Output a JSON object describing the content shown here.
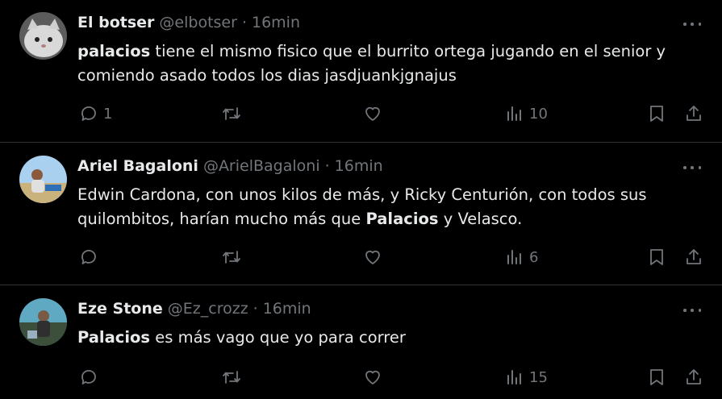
{
  "tweets": [
    {
      "name": "El botser",
      "handle": "@elbotser",
      "time": "16min",
      "text_parts": [
        {
          "bold": true,
          "t": "palacios"
        },
        {
          "bold": false,
          "t": " tiene el mismo fisico que el burrito ortega jugando en el senior y comiendo asado todos los dias jasdjuankjgnajus"
        }
      ],
      "reply_count": "1",
      "retweet_count": "",
      "like_count": "",
      "views": "10",
      "avatar_colors": [
        "#8a8a8a",
        "#e6e6e6"
      ]
    },
    {
      "name": "Ariel Bagaloni",
      "handle": "@ArielBagaloni",
      "time": "16min",
      "text_parts": [
        {
          "bold": false,
          "t": "Edwin Cardona, con unos kilos de más, y Ricky Centurión, con todos sus quilombitos, harían mucho más que "
        },
        {
          "bold": true,
          "t": "Palacios"
        },
        {
          "bold": false,
          "t": " y Velasco."
        }
      ],
      "reply_count": "",
      "retweet_count": "",
      "like_count": "",
      "views": "6",
      "avatar_colors": [
        "#9fc6e6",
        "#c8b07a"
      ]
    },
    {
      "name": "Eze Stone",
      "handle": "@Ez_crozz",
      "time": "16min",
      "text_parts": [
        {
          "bold": true,
          "t": "Palacios"
        },
        {
          "bold": false,
          "t": " es más vago que yo para correr"
        }
      ],
      "reply_count": "",
      "retweet_count": "",
      "like_count": "",
      "views": "15",
      "avatar_colors": [
        "#5fa9c2",
        "#3b4f3a"
      ]
    }
  ],
  "icons": {
    "more": "more-horizontal-icon",
    "reply": "reply-bubble-icon",
    "retweet": "retweet-icon",
    "like": "heart-icon",
    "views": "bar-chart-icon",
    "bookmark": "bookmark-icon",
    "share": "share-upload-icon"
  },
  "colors": {
    "text": "#e7e9ea",
    "muted": "#71767b",
    "divider": "#2f3336",
    "background": "#000000"
  }
}
